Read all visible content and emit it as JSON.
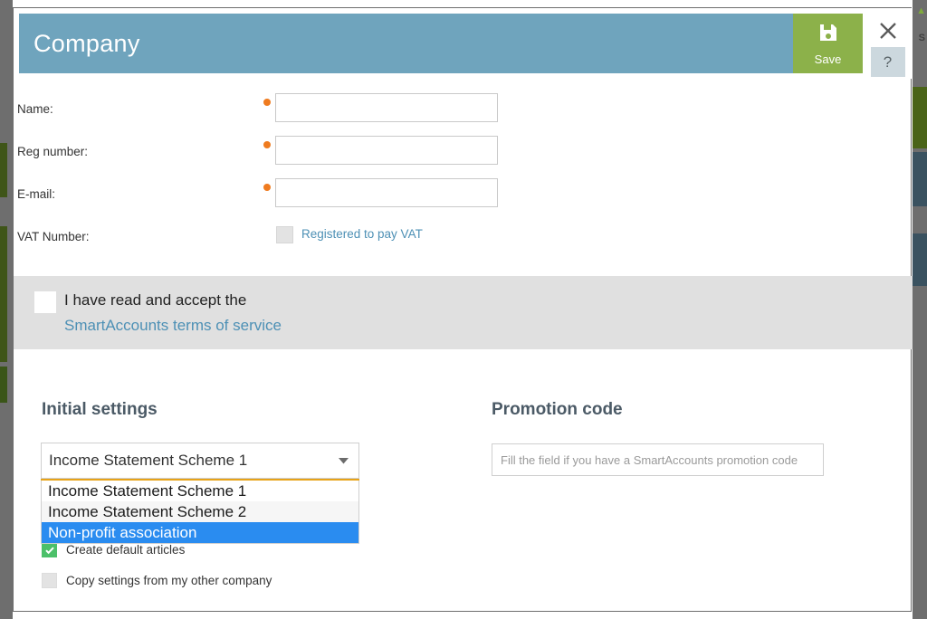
{
  "window": {
    "title": "Company",
    "save_label": "Save",
    "save_icon": "floppy-disk-icon",
    "close_icon": "close-icon",
    "help_label": "?"
  },
  "form": {
    "fields": [
      {
        "label": "Name:",
        "value": "",
        "required": true
      },
      {
        "label": "Reg number:",
        "value": "",
        "required": true
      },
      {
        "label": "E-mail:",
        "value": "",
        "required": true
      }
    ],
    "vat": {
      "label": "VAT Number:",
      "checkbox_label": "Registered to pay VAT",
      "checked": false
    }
  },
  "terms": {
    "checked": false,
    "line1": "I have read and accept the",
    "link": "SmartAccounts terms of service"
  },
  "initial_settings": {
    "title": "Initial settings",
    "select": {
      "value": "Income Statement Scheme 1",
      "expanded": true,
      "options": [
        {
          "label": "Income Statement Scheme 1",
          "selected": false
        },
        {
          "label": "Income Statement Scheme 2",
          "selected": false
        },
        {
          "label": "Non-profit association",
          "selected": true
        }
      ]
    },
    "checkboxes": [
      {
        "label": "Create default articles",
        "checked": true
      },
      {
        "label": "Copy settings from my other company",
        "checked": false
      }
    ]
  },
  "promotion": {
    "title": "Promotion code",
    "value": "",
    "placeholder": "Fill the field if you have a SmartAccounts promotion code"
  },
  "background": {
    "right_glyph": "▲",
    "right_letter": "S"
  },
  "colors": {
    "header_teal": "#6fa4bd",
    "save_green": "#8cb14a",
    "required_orange": "#ef7b1f",
    "link_blue": "#4d90b5",
    "option_highlight": "#2a8cf0",
    "select_underline": "#e8a317",
    "section_title": "#4b5a66",
    "terms_band": "#e0e0e0"
  }
}
